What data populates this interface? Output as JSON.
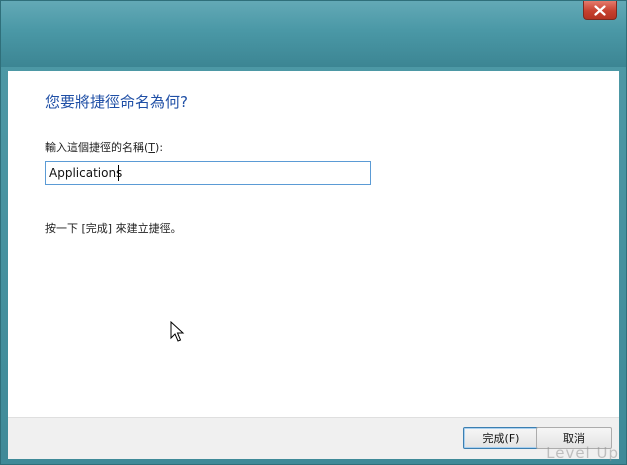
{
  "window": {
    "close_icon": "close-icon"
  },
  "dialog": {
    "heading": "您要將捷徑命名為何?",
    "name_label_prefix": "輸入這個捷徑的名稱(",
    "name_label_shortcut": "T",
    "name_label_suffix": "):",
    "name_value": "Applications",
    "hint": "按一下 [完成] 來建立捷徑。"
  },
  "buttons": {
    "finish": "完成(F)",
    "cancel": "取消"
  },
  "watermark": "Level Up",
  "colors": {
    "heading": "#1f4fa6",
    "input_border": "#5b9bd5",
    "titlebar": "#4a98a6"
  }
}
